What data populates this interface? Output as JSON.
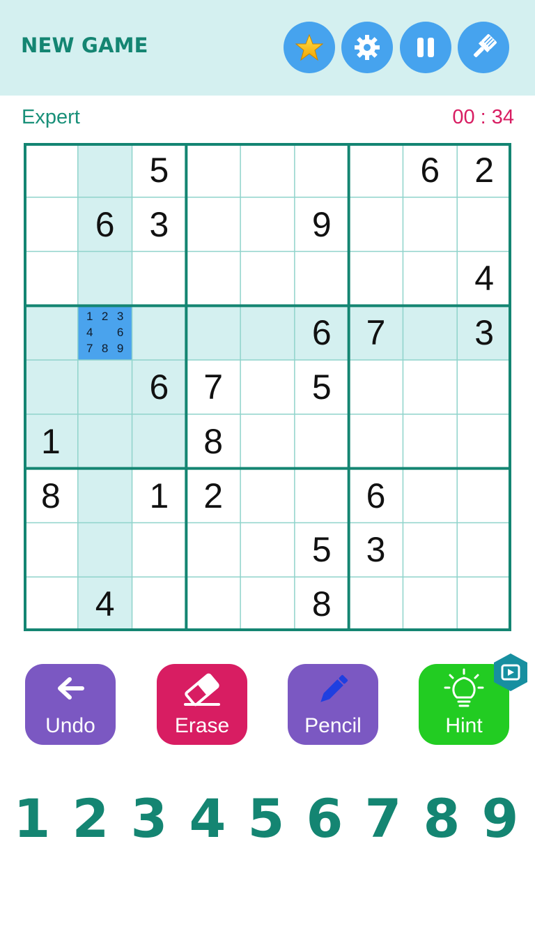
{
  "header": {
    "new_game_label": "NEW GAME",
    "buttons": [
      {
        "name": "favorite-button",
        "icon": "star-icon"
      },
      {
        "name": "settings-button",
        "icon": "gear-icon"
      },
      {
        "name": "pause-button",
        "icon": "pause-icon"
      },
      {
        "name": "theme-button",
        "icon": "paintbrush-icon"
      }
    ]
  },
  "status": {
    "difficulty": "Expert",
    "timer": "00 : 34"
  },
  "board": {
    "grid": [
      [
        0,
        0,
        5,
        0,
        0,
        0,
        0,
        6,
        2
      ],
      [
        0,
        6,
        3,
        0,
        0,
        9,
        0,
        0,
        0
      ],
      [
        0,
        0,
        0,
        0,
        0,
        0,
        0,
        0,
        4
      ],
      [
        0,
        0,
        0,
        0,
        0,
        6,
        7,
        0,
        3
      ],
      [
        0,
        0,
        6,
        7,
        0,
        5,
        0,
        0,
        0
      ],
      [
        1,
        0,
        0,
        8,
        0,
        0,
        0,
        0,
        0
      ],
      [
        8,
        0,
        1,
        2,
        0,
        0,
        6,
        0,
        0
      ],
      [
        0,
        0,
        0,
        0,
        0,
        5,
        3,
        0,
        0
      ],
      [
        0,
        4,
        0,
        0,
        0,
        8,
        0,
        0,
        0
      ]
    ],
    "selected": {
      "row": 3,
      "col": 1
    },
    "selected_notes": [
      "1",
      "2",
      "3",
      "4",
      "",
      "6",
      "7",
      "8",
      "9"
    ]
  },
  "actions": [
    {
      "name": "undo-button",
      "label": "Undo",
      "icon": "arrow-left-icon",
      "color": "#7b58c2"
    },
    {
      "name": "erase-button",
      "label": "Erase",
      "icon": "eraser-icon",
      "color": "#d81d62"
    },
    {
      "name": "pencil-button",
      "label": "Pencil",
      "icon": "pencil-icon",
      "color": "#7b58c2"
    },
    {
      "name": "hint-button",
      "label": "Hint",
      "icon": "lightbulb-icon",
      "color": "#22cc22"
    }
  ],
  "numpad": [
    "1",
    "2",
    "3",
    "4",
    "5",
    "6",
    "7",
    "8",
    "9"
  ],
  "colors": {
    "accent": "#148572",
    "highlight": "#d4f0f0",
    "selected": "#4aa3ed",
    "timer": "#d81d62",
    "header_button": "#46a3ee"
  }
}
